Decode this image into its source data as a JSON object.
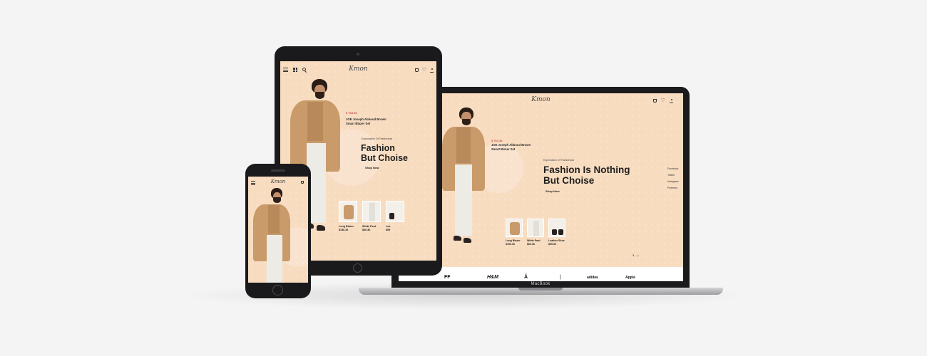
{
  "brand": {
    "logo": "Kmon"
  },
  "hero": {
    "price": "$ 764.36",
    "product_line1": "JOE Joseph Abboud Brown",
    "product_line2": "Smart Blazer Set",
    "kicker": "Expectation Of Fashionista",
    "headline_line1": "Fashion Is Nothing",
    "headline_line2": "But Choise",
    "tablet_headline_line1": "Fashion",
    "tablet_headline_line2": "But Choise",
    "tablet_kicker": "Expectation Of Fashionista",
    "cta": "Shop Now"
  },
  "products": [
    {
      "name": "Long Blazer",
      "price": "$156.36"
    },
    {
      "name": "White Pant",
      "price": "$66.36"
    },
    {
      "name": "Leather Shoe",
      "price": "$59.36"
    }
  ],
  "tablet_third_product": {
    "name": "Lea",
    "price": "$59"
  },
  "social": [
    "Facebook",
    "Twitter",
    "Instagram",
    "Pinterest"
  ],
  "pager": {
    "current": "1",
    "divider": "—"
  },
  "brands": [
    "FF",
    "H&M",
    "Ă",
    "|",
    "adidas",
    "Apple"
  ],
  "device": {
    "laptop_label": "MacBook"
  },
  "colors": {
    "site_bg": "#f8dcc0",
    "price": "#c0504a",
    "device_frame": "#1b1b1d",
    "page_bg": "#f4f4f4"
  }
}
